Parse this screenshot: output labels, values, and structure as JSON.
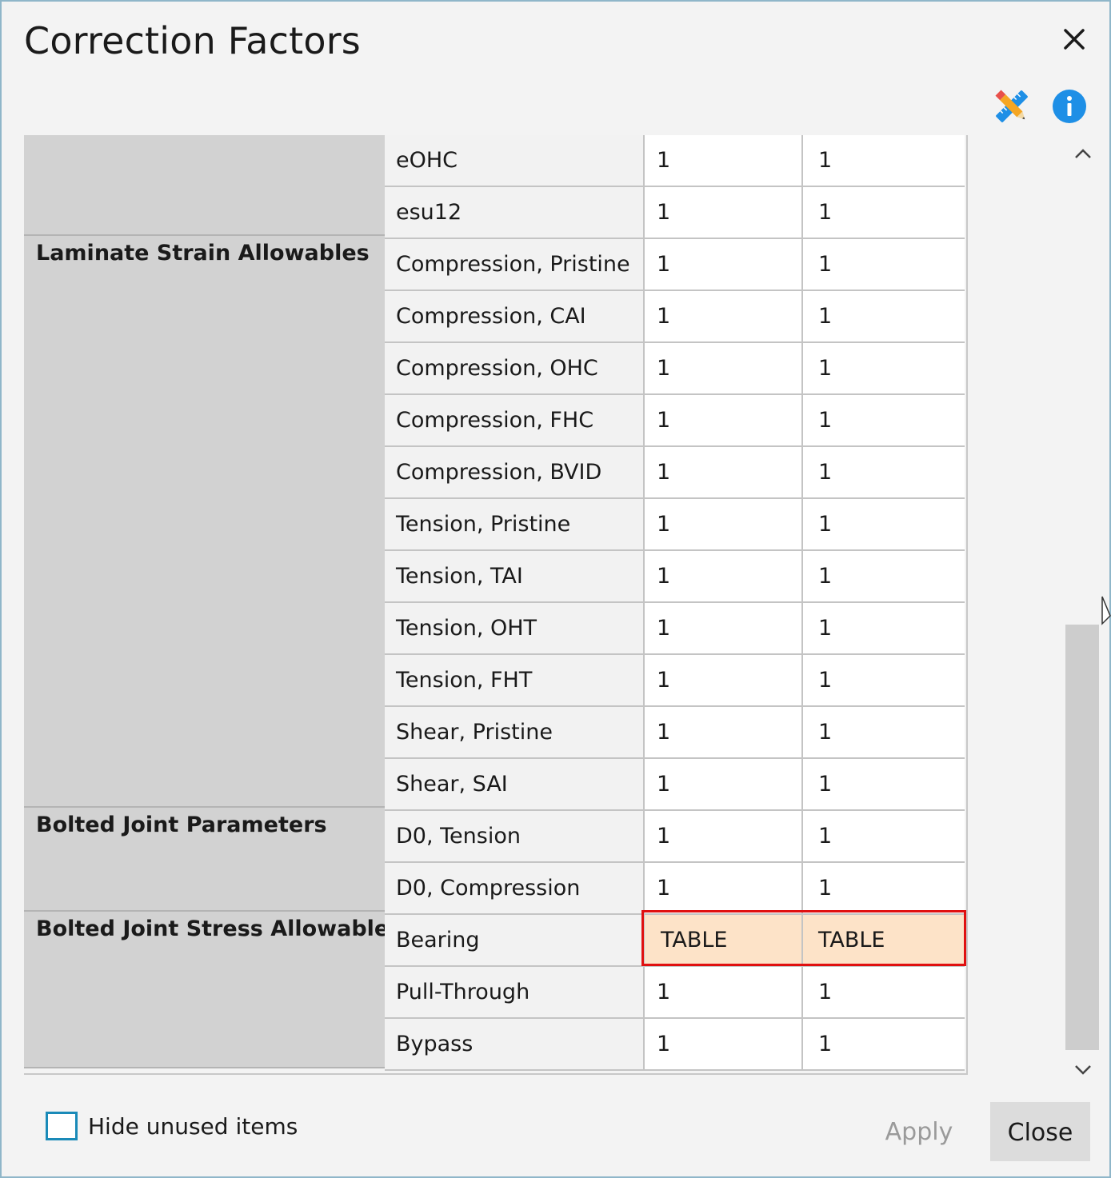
{
  "window": {
    "title": "Correction Factors"
  },
  "toolbar": {
    "tool_icon": "pencil-ruler-icon",
    "info_icon": "info-icon",
    "close_icon": "close-icon",
    "accent_blue": "#1e8fe6",
    "highlight_border": "#e01010",
    "highlight_fill": "#fde3c8"
  },
  "groups": [
    {
      "label": ""
    },
    {
      "label": "Laminate Strain Allowables"
    },
    {
      "label": "Bolted Joint Parameters"
    },
    {
      "label": "Bolted Joint Stress Allowables"
    }
  ],
  "rows": [
    {
      "name": "eOHC",
      "v1": "1",
      "v2": "1"
    },
    {
      "name": "esu12",
      "v1": "1",
      "v2": "1"
    },
    {
      "name": "Compression, Pristine",
      "v1": "1",
      "v2": "1"
    },
    {
      "name": "Compression, CAI",
      "v1": "1",
      "v2": "1"
    },
    {
      "name": "Compression, OHC",
      "v1": "1",
      "v2": "1"
    },
    {
      "name": "Compression, FHC",
      "v1": "1",
      "v2": "1"
    },
    {
      "name": "Compression, BVID",
      "v1": "1",
      "v2": "1"
    },
    {
      "name": "Tension, Pristine",
      "v1": "1",
      "v2": "1"
    },
    {
      "name": "Tension, TAI",
      "v1": "1",
      "v2": "1"
    },
    {
      "name": "Tension, OHT",
      "v1": "1",
      "v2": "1"
    },
    {
      "name": "Tension, FHT",
      "v1": "1",
      "v2": "1"
    },
    {
      "name": "Shear, Pristine",
      "v1": "1",
      "v2": "1"
    },
    {
      "name": "Shear, SAI",
      "v1": "1",
      "v2": "1"
    },
    {
      "name": "D0, Tension",
      "v1": "1",
      "v2": "1"
    },
    {
      "name": "D0, Compression",
      "v1": "1",
      "v2": "1"
    },
    {
      "name": "Bearing",
      "v1": "TABLE",
      "v2": "TABLE"
    },
    {
      "name": "Pull-Through",
      "v1": "1",
      "v2": "1"
    },
    {
      "name": "Bypass",
      "v1": "1",
      "v2": "1"
    }
  ],
  "footer": {
    "hide_unused_label": "Hide unused items",
    "hide_unused_checked": false,
    "apply_label": "Apply",
    "close_label": "Close"
  }
}
